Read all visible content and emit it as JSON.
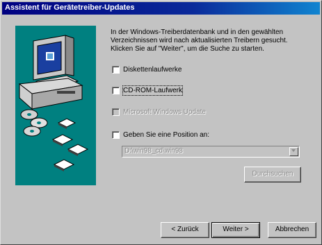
{
  "window": {
    "title": "Assistent für Gerätetreiber-Updates"
  },
  "description": {
    "line1": "In der Windows-Treiberdatenbank und in den gewählten",
    "line2": "Verzeichnissen wird nach aktualisierten Treibern gesucht.",
    "line3": "Klicken Sie auf \"Weiter\", um die Suche zu starten."
  },
  "options": [
    {
      "label": "Diskettenlaufwerke",
      "checked": false,
      "enabled": true
    },
    {
      "label": "CD-ROM-Laufwerk",
      "checked": false,
      "enabled": true
    },
    {
      "label": "Microsoft Windows Update",
      "checked": false,
      "enabled": false
    },
    {
      "label": "Geben Sie eine Position an:",
      "checked": false,
      "enabled": true
    }
  ],
  "location": {
    "value": "D:\\win98_cd\\win98"
  },
  "buttons": {
    "browse": "Durchsuchen",
    "back": "< Zurück",
    "next": "Weiter >",
    "cancel": "Abbrechen"
  },
  "colors": {
    "title_bar": "#000080",
    "face": "#c3c3c3",
    "picture_bg": "#008080"
  },
  "icons": [
    "computer-icon",
    "cd-icon",
    "floppy-disk-icon",
    "chevron-down-icon"
  ]
}
